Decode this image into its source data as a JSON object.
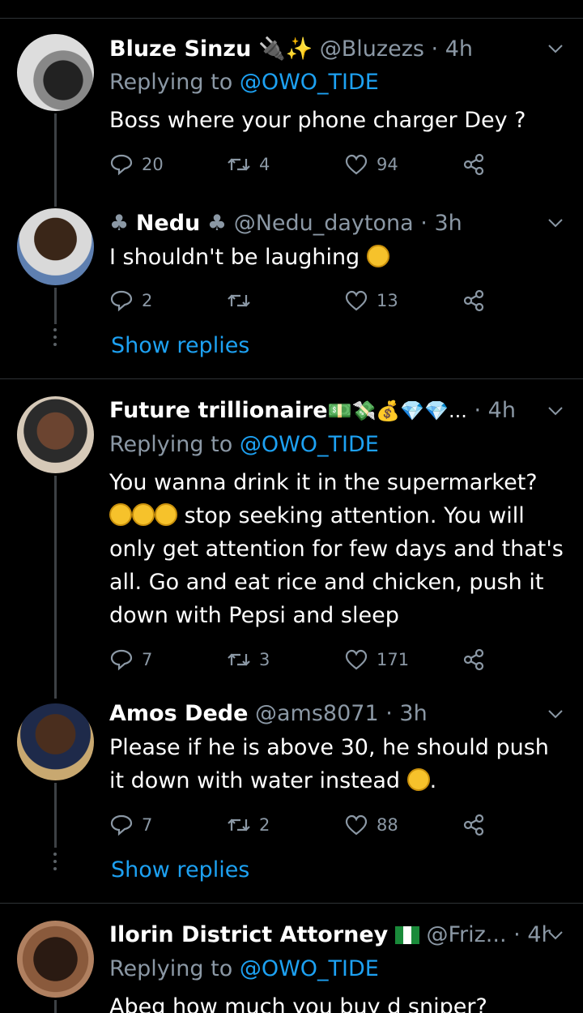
{
  "tweets": [
    {
      "name": "Bluze Sinzu",
      "name_suffix": "🔌✨",
      "handle": "@Bluzezs",
      "time": "· 4h",
      "replying_prefix": "Replying to",
      "replying_handle": "@OWO_TIDE",
      "text": "Boss where your phone charger Dey ?",
      "replies": "20",
      "retweets": "4",
      "likes": "94"
    },
    {
      "name": "Nedu",
      "name_prefix": "♣",
      "name_suffix": "♣",
      "handle": "@Nedu_daytona",
      "time": "· 3h",
      "text": "I shouldn't be laughing",
      "replies": "2",
      "retweets": "",
      "likes": "13",
      "show_replies": "Show replies"
    },
    {
      "name": "Future trillionaire",
      "name_suffix": "💵💸💰💎💎...",
      "handle": "",
      "time": "· 4h",
      "replying_prefix": "Replying to",
      "replying_handle": "@OWO_TIDE",
      "text_line1": "You wanna drink it in the supermarket?",
      "text_rest": "stop seeking attention. You will only get attention for few days and that's all. Go and  eat rice and chicken, push it down with Pepsi and sleep",
      "replies": "7",
      "retweets": "3",
      "likes": "171"
    },
    {
      "name": "Amos Dede",
      "handle": "@ams8071",
      "time": "· 3h",
      "text": "Please if he is above 30, he should push it down with water instead",
      "text_end": ".",
      "replies": "7",
      "retweets": "2",
      "likes": "88",
      "show_replies": "Show replies"
    },
    {
      "name": "Ilorin District Attorney",
      "handle": "@Friz...",
      "time": "· 4h",
      "replying_prefix": "Replying to",
      "replying_handle": "@OWO_TIDE",
      "text": "Abeg how much you buy d sniper?"
    }
  ]
}
